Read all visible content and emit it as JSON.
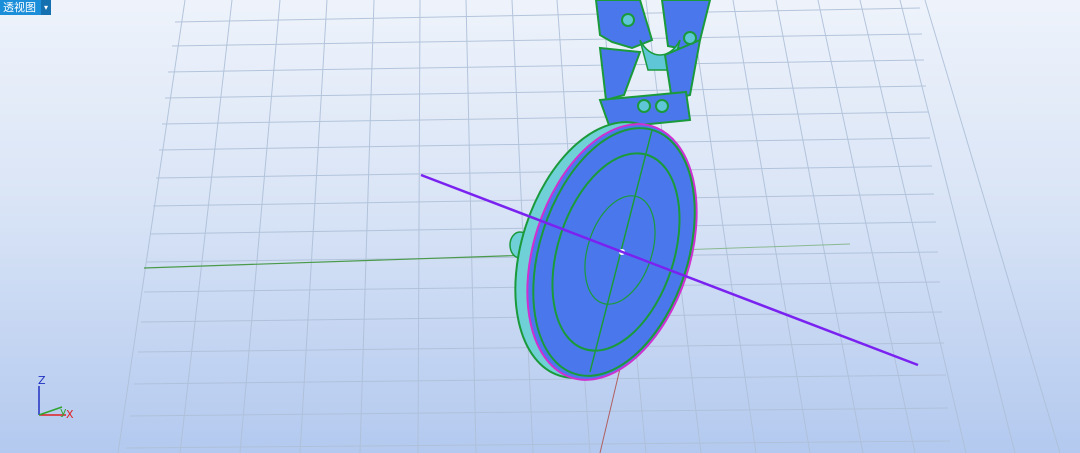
{
  "viewport": {
    "title": "透视图",
    "dropdown_icon": "triangle-down-icon"
  },
  "axis_widget": {
    "z_label": "Z",
    "y_label": "y",
    "x_label": "X",
    "colors": {
      "x": "#e02020",
      "y": "#2fa52f",
      "z": "#2030c0"
    }
  },
  "scene": {
    "colors": {
      "grid": "#aec0d8",
      "green_axis": "#4a9a4a",
      "purple_line": "#7a22f0",
      "red_axis": "#b06060",
      "model_fill": "#4a78ec",
      "model_edge": "#1a9a3a",
      "model_rim": "#6fd0d8",
      "highlight": "#d030d0"
    }
  }
}
